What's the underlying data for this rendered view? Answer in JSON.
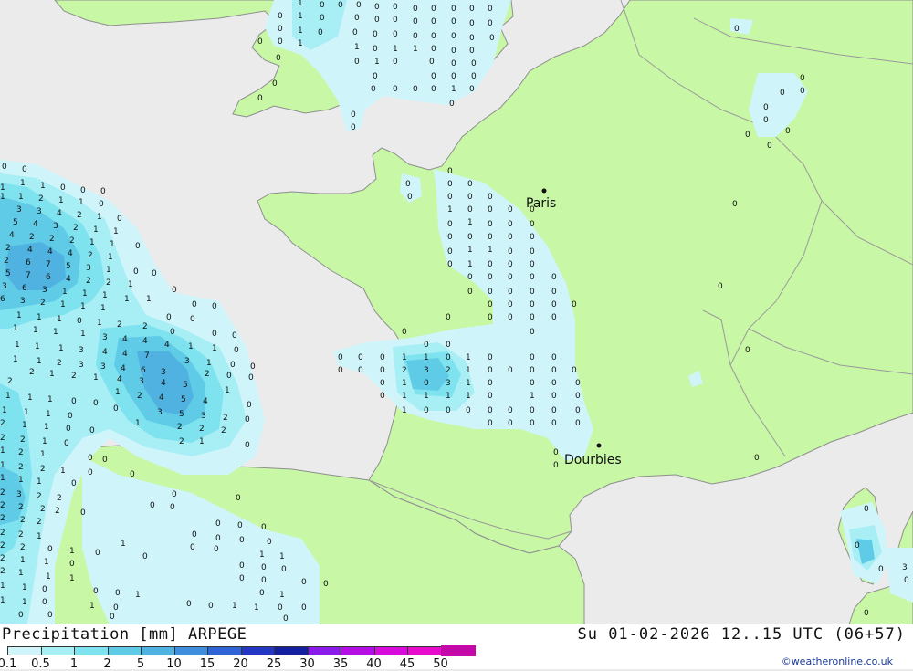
{
  "map": {
    "colors": {
      "sea": "#ebebeb",
      "land": "#c8f7a6",
      "border": "#9a9a9a",
      "coast": "#8e8e8e"
    },
    "cities": [
      {
        "name": "Paris"
      },
      {
        "name": "Dourbies"
      }
    ]
  },
  "footer": {
    "title": "Precipitation [mm] ARPEGE",
    "datetime": "Su 01-02-2026 12..15 UTC (06+57)",
    "credit": "©weatheronline.co.uk"
  },
  "legend": {
    "thresholds": [
      "0.1",
      "0.5",
      "1",
      "2",
      "5",
      "10",
      "15",
      "20",
      "25",
      "30",
      "35",
      "40",
      "45",
      "50"
    ],
    "colors": [
      "#cff5fa",
      "#a7eef5",
      "#7fe3ef",
      "#5fcbe6",
      "#4fb2e0",
      "#3f8edb",
      "#2f63d6",
      "#2336c4",
      "#1420a0",
      "#8a1be8",
      "#b40ee5",
      "#d60bdc",
      "#e80bcc",
      "#c30aa8"
    ]
  }
}
